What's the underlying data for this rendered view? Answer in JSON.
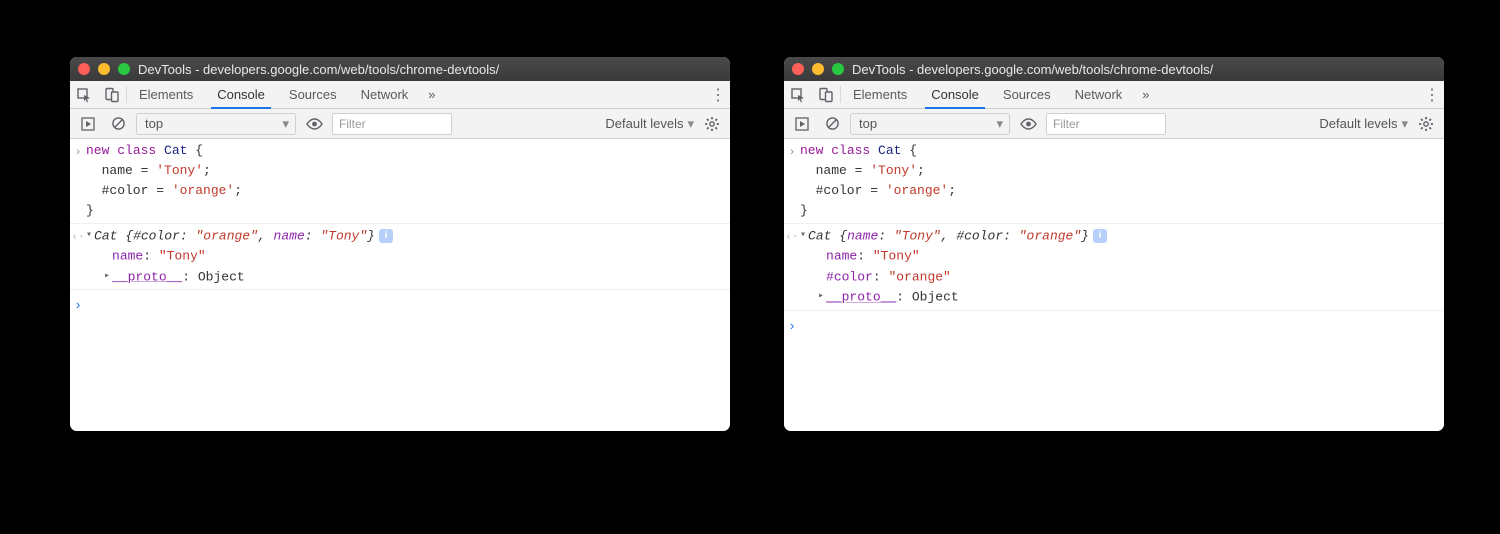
{
  "windows": [
    {
      "title": "DevTools - developers.google.com/web/tools/chrome-devtools/",
      "tabs": [
        "Elements",
        "Console",
        "Sources",
        "Network"
      ],
      "activeTab": "Console",
      "moreTabs": "»",
      "toolbar": {
        "context": "top",
        "filterPlaceholder": "Filter",
        "levels": "Default levels"
      },
      "input": {
        "lines": [
          [
            {
              "t": "new ",
              "c": "kw"
            },
            {
              "t": "class ",
              "c": "kw"
            },
            {
              "t": "Cat",
              "c": "cls"
            },
            {
              "t": " {",
              "c": ""
            }
          ],
          [
            {
              "t": "  name = ",
              "c": ""
            },
            {
              "t": "'Tony'",
              "c": "str"
            },
            {
              "t": ";",
              "c": ""
            }
          ],
          [
            {
              "t": "  #color = ",
              "c": ""
            },
            {
              "t": "'orange'",
              "c": "str"
            },
            {
              "t": ";",
              "c": ""
            }
          ],
          [
            {
              "t": "}",
              "c": ""
            }
          ]
        ]
      },
      "output": {
        "summary": [
          {
            "t": "Cat ",
            "c": "obj",
            "i": true
          },
          {
            "t": "{",
            "c": "obj",
            "i": true
          },
          {
            "t": "#color",
            "c": "priv",
            "i": true
          },
          {
            "t": ": ",
            "c": "obj",
            "i": true
          },
          {
            "t": "\"orange\"",
            "c": "str",
            "i": true
          },
          {
            "t": ", ",
            "c": "obj",
            "i": true
          },
          {
            "t": "name",
            "c": "prop",
            "i": true
          },
          {
            "t": ": ",
            "c": "obj",
            "i": true
          },
          {
            "t": "\"Tony\"",
            "c": "str",
            "i": true
          },
          {
            "t": "}",
            "c": "obj",
            "i": true
          }
        ],
        "children": [
          {
            "expandable": false,
            "tokens": [
              {
                "t": "name",
                "c": "prop"
              },
              {
                "t": ": ",
                "c": ""
              },
              {
                "t": "\"Tony\"",
                "c": "str"
              }
            ]
          },
          {
            "expandable": true,
            "tokens": [
              {
                "t": "__proto__",
                "c": "protolink"
              },
              {
                "t": ": ",
                "c": ""
              },
              {
                "t": "Object",
                "c": "obj"
              }
            ]
          }
        ],
        "info": "i"
      }
    },
    {
      "title": "DevTools - developers.google.com/web/tools/chrome-devtools/",
      "tabs": [
        "Elements",
        "Console",
        "Sources",
        "Network"
      ],
      "activeTab": "Console",
      "moreTabs": "»",
      "toolbar": {
        "context": "top",
        "filterPlaceholder": "Filter",
        "levels": "Default levels"
      },
      "input": {
        "lines": [
          [
            {
              "t": "new ",
              "c": "kw"
            },
            {
              "t": "class ",
              "c": "kw"
            },
            {
              "t": "Cat",
              "c": "cls"
            },
            {
              "t": " {",
              "c": ""
            }
          ],
          [
            {
              "t": "  name = ",
              "c": ""
            },
            {
              "t": "'Tony'",
              "c": "str"
            },
            {
              "t": ";",
              "c": ""
            }
          ],
          [
            {
              "t": "  #color = ",
              "c": ""
            },
            {
              "t": "'orange'",
              "c": "str"
            },
            {
              "t": ";",
              "c": ""
            }
          ],
          [
            {
              "t": "}",
              "c": ""
            }
          ]
        ]
      },
      "output": {
        "summary": [
          {
            "t": "Cat ",
            "c": "obj",
            "i": true
          },
          {
            "t": "{",
            "c": "obj",
            "i": true
          },
          {
            "t": "name",
            "c": "prop",
            "i": true
          },
          {
            "t": ": ",
            "c": "obj",
            "i": true
          },
          {
            "t": "\"Tony\"",
            "c": "str",
            "i": true
          },
          {
            "t": ", ",
            "c": "obj",
            "i": true
          },
          {
            "t": "#color",
            "c": "priv",
            "i": true
          },
          {
            "t": ": ",
            "c": "obj",
            "i": true
          },
          {
            "t": "\"orange\"",
            "c": "str",
            "i": true
          },
          {
            "t": "}",
            "c": "obj",
            "i": true
          }
        ],
        "children": [
          {
            "expandable": false,
            "tokens": [
              {
                "t": "name",
                "c": "prop"
              },
              {
                "t": ": ",
                "c": ""
              },
              {
                "t": "\"Tony\"",
                "c": "str"
              }
            ]
          },
          {
            "expandable": false,
            "tokens": [
              {
                "t": "#color",
                "c": "prop"
              },
              {
                "t": ": ",
                "c": ""
              },
              {
                "t": "\"orange\"",
                "c": "str"
              }
            ]
          },
          {
            "expandable": true,
            "tokens": [
              {
                "t": "__proto__",
                "c": "protolink"
              },
              {
                "t": ": ",
                "c": ""
              },
              {
                "t": "Object",
                "c": "obj"
              }
            ]
          }
        ],
        "info": "i"
      }
    }
  ],
  "glyphs": {
    "chevron": "▸",
    "chevronDown": "▾",
    "outArrow": "‹",
    "inArrow": "›",
    "prompt": "›",
    "dropdown": "▾",
    "more": "»"
  }
}
